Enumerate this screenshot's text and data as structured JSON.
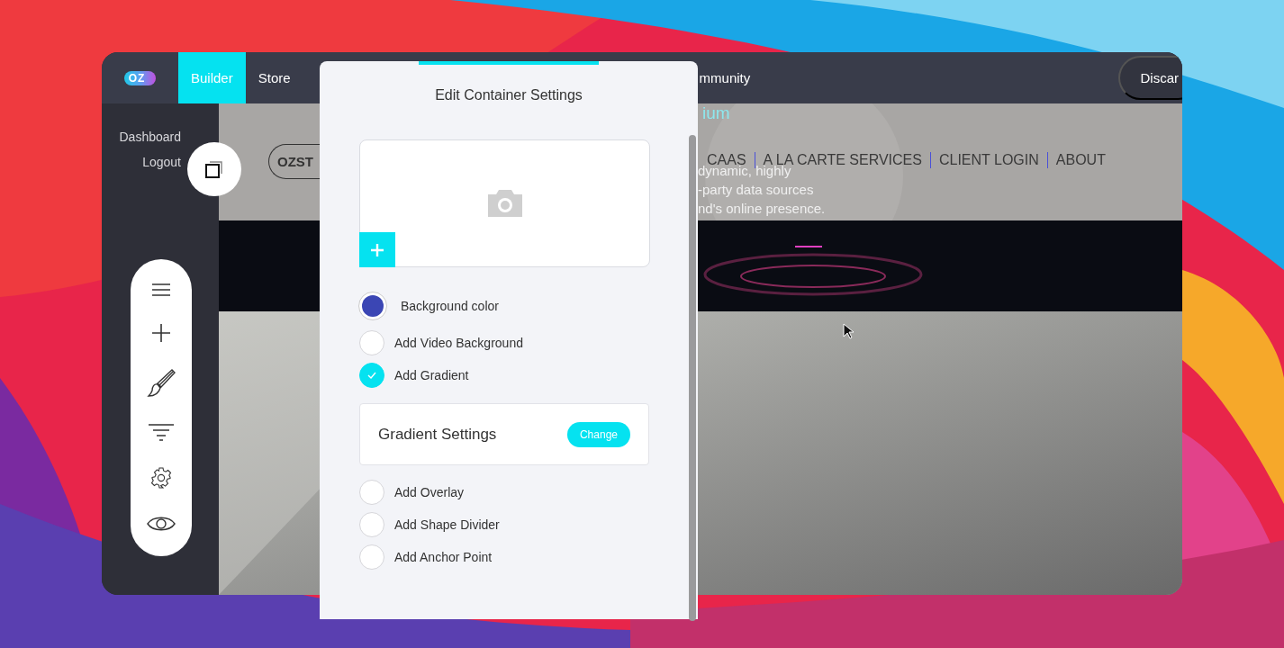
{
  "topbar": {
    "logo": "OZ",
    "tabs": [
      {
        "label": "Builder",
        "selected": true
      },
      {
        "label": "Store",
        "selected": false
      },
      {
        "label": "mmunity",
        "selected": false
      }
    ],
    "discard": "Discar"
  },
  "sidebar": {
    "links": [
      "Dashboard",
      "Logout"
    ]
  },
  "site": {
    "logo": "OZST",
    "tagline": "ium",
    "menu": [
      "CAAS",
      "A LA CARTE SERVICES",
      "CLIENT LOGIN",
      "ABOUT"
    ],
    "description": [
      "dynamic, highly",
      "-party data sources",
      "nd's online presence."
    ]
  },
  "modal": {
    "title": "Edit Container Settings",
    "options": [
      {
        "kind": "color",
        "label": "Background color",
        "color": "#3b46b4"
      },
      {
        "kind": "toggle",
        "label": "Add Video Background",
        "checked": false
      },
      {
        "kind": "toggle",
        "label": "Add Gradient",
        "checked": true
      },
      {
        "kind": "card",
        "label": "Gradient Settings",
        "button": "Change"
      },
      {
        "kind": "toggle",
        "label": "Add Overlay",
        "checked": false
      },
      {
        "kind": "toggle",
        "label": "Add Shape Divider",
        "checked": false
      },
      {
        "kind": "toggle",
        "label": "Add Anchor Point",
        "checked": false
      }
    ]
  }
}
